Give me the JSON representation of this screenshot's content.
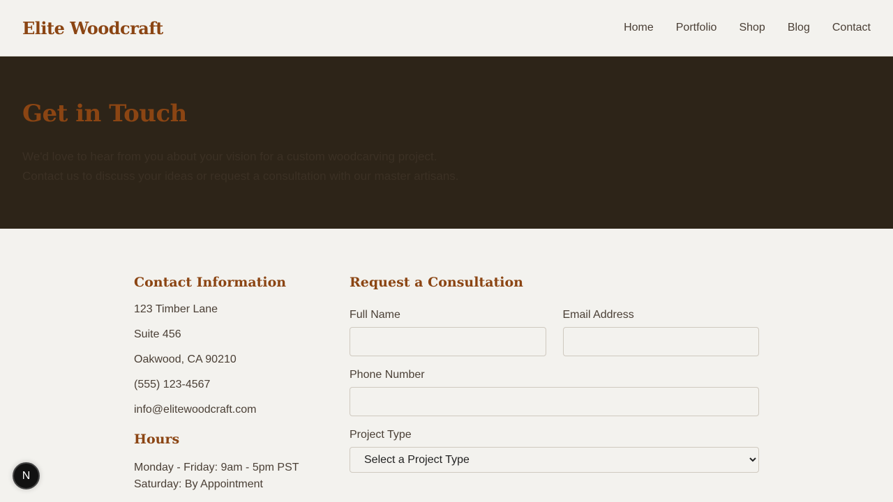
{
  "header": {
    "logo": "Elite Woodcraft",
    "nav": [
      "Home",
      "Portfolio",
      "Shop",
      "Blog",
      "Contact"
    ]
  },
  "hero": {
    "title": "Get in Touch",
    "line1": "We'd love to hear from you about your vision for a custom woodcarving project.",
    "line2": "Contact us to discuss your ideas or request a consultation with our master artisans."
  },
  "contact": {
    "title": "Contact Information",
    "address1": "123 Timber Lane",
    "address2": "Suite 456",
    "city": "Oakwood, CA 90210",
    "phone": "(555) 123-4567",
    "email": "info@elitewoodcraft.com"
  },
  "hours": {
    "title": "Hours",
    "weekday": "Monday - Friday: 9am - 5pm PST",
    "saturday": "Saturday: By Appointment"
  },
  "form": {
    "title": "Request a Consultation",
    "full_name_label": "Full Name",
    "email_label": "Email Address",
    "phone_label": "Phone Number",
    "project_type_label": "Project Type",
    "project_type_value": "Select a Project Type"
  },
  "badge": {
    "letter": "N"
  },
  "colors": {
    "accent": "#8b4513",
    "hero_bg": "#2d2418",
    "page_bg": "#f3f2ee"
  }
}
